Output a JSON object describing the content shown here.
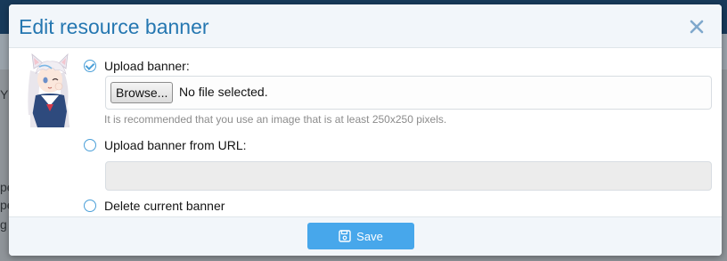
{
  "dialog": {
    "title": "Edit resource banner",
    "close_icon": "close-icon",
    "accent_color": "#2577b1"
  },
  "options": {
    "upload": {
      "label": "Upload banner:",
      "selected": true,
      "browse_label": "Browse...",
      "file_status": "No file selected.",
      "hint": "It is recommended that you use an image that is at least 250x250 pixels."
    },
    "url": {
      "label": "Upload banner from URL:",
      "selected": false,
      "value": ""
    },
    "delete": {
      "label": "Delete current banner",
      "selected": false
    }
  },
  "footer": {
    "save_label": "Save",
    "save_icon": "save-icon",
    "save_color": "#47a7eb"
  },
  "background": {
    "fragments": [
      "Y",
      "pe",
      "pe",
      "g"
    ]
  }
}
